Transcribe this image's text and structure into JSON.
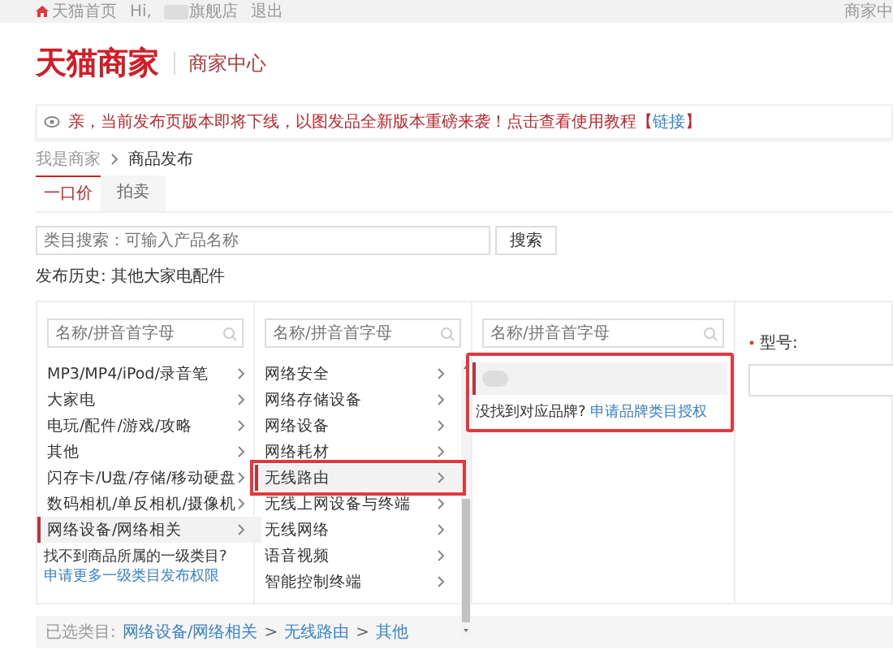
{
  "top_bar": {
    "home_link": "天猫首页",
    "greeting": "Hi,",
    "shop_name": "旗舰店",
    "logout": "退出",
    "right_link": "商家中"
  },
  "header": {
    "logo": "天猫商家",
    "subtitle": "商家中心"
  },
  "notice": {
    "text": "亲，当前发布页版本即将下线，以图发品全新版本重磅来袭！点击查看使用教程【",
    "link": "链接",
    "text_end": "】"
  },
  "breadcrumb": [
    "我是商家",
    "商品发布"
  ],
  "tabs": [
    {
      "label": "一口价",
      "selected": true
    },
    {
      "label": "拍卖",
      "selected": false
    }
  ],
  "category_search": {
    "placeholder": "类目搜索：可输入产品名称",
    "button": "搜索"
  },
  "history": "发布历史: 其他大家电配件",
  "category_columns": [
    {
      "placeholder": "名称/拼音首字母",
      "items": [
        {
          "label": "MP3/MP4/iPod/录音笔",
          "selected": false,
          "annotated": false
        },
        {
          "label": "大家电",
          "selected": false,
          "annotated": false
        },
        {
          "label": "电玩/配件/游戏/攻略",
          "selected": false,
          "annotated": false
        },
        {
          "label": "其他",
          "selected": false,
          "annotated": false
        },
        {
          "label": "闪存卡/U盘/存储/移动硬盘",
          "selected": false,
          "annotated": false
        },
        {
          "label": "数码相机/单反相机/摄像机",
          "selected": false,
          "annotated": false
        },
        {
          "label": "网络设备/网络相关",
          "selected": true,
          "annotated": false
        }
      ],
      "footer": {
        "text": "找不到商品所属的一级类目?",
        "link": "申请更多一级类目发布权限"
      }
    },
    {
      "placeholder": "名称/拼音首字母",
      "scrollable": true,
      "items": [
        {
          "label": "网络安全",
          "selected": false,
          "annotated": false
        },
        {
          "label": "网络存储设备",
          "selected": false,
          "annotated": false
        },
        {
          "label": "网络设备",
          "selected": false,
          "annotated": false
        },
        {
          "label": "网络耗材",
          "selected": false,
          "annotated": false
        },
        {
          "label": "无线路由",
          "selected": true,
          "annotated": true
        },
        {
          "label": "无线上网设备与终端",
          "selected": false,
          "annotated": false
        },
        {
          "label": "无线网络",
          "selected": false,
          "annotated": false
        },
        {
          "label": "语音视频",
          "selected": false,
          "annotated": false
        },
        {
          "label": "智能控制终端",
          "selected": false,
          "annotated": false
        }
      ]
    }
  ],
  "brand_column": {
    "placeholder": "名称/拼音首字母",
    "annotated": true,
    "brands": [
      {
        "selected": true
      }
    ],
    "footer": {
      "text": "没找到对应品牌?",
      "link": "申请品牌类目授权"
    }
  },
  "attributes": [
    {
      "label": "型号:",
      "required": true
    }
  ],
  "selected_path": {
    "label": "已选类目:",
    "parts": [
      "网络设备/网络相关",
      "无线路由",
      "其他"
    ],
    "separator": ">"
  }
}
